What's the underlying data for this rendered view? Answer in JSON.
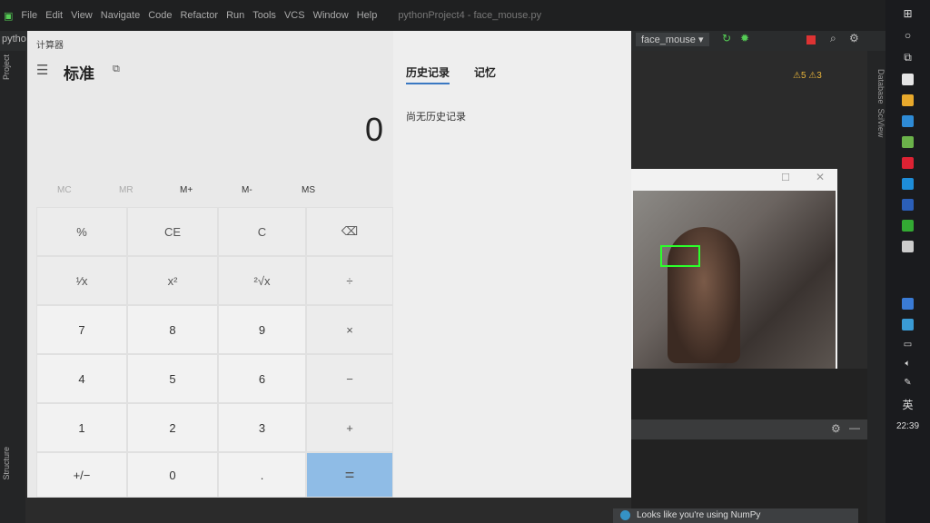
{
  "ide": {
    "menu": [
      "File",
      "Edit",
      "View",
      "Navigate",
      "Code",
      "Refactor",
      "Run",
      "Tools",
      "VCS",
      "Window",
      "Help"
    ],
    "title": "pythonProject4 - face_mouse.py",
    "project": "pytho",
    "run_config": "face_mouse",
    "warnings": "5",
    "weak_warnings": "3",
    "side_tabs": [
      "Database",
      "SciView"
    ],
    "left_tabs": [
      "Project",
      "Structure"
    ],
    "notification": "Looks like you're using NumPy"
  },
  "calculator": {
    "window_title": "计算器",
    "mode": "标准",
    "display": "0",
    "memory": [
      "MC",
      "MR",
      "M+",
      "M-",
      "MS"
    ],
    "buttons": [
      [
        "%",
        "CE",
        "C",
        "⌫"
      ],
      [
        "¹⁄x",
        "x²",
        "²√x",
        "÷"
      ],
      [
        "7",
        "8",
        "9",
        "×"
      ],
      [
        "4",
        "5",
        "6",
        "−"
      ],
      [
        "1",
        "2",
        "3",
        "+"
      ],
      [
        "+/−",
        "0",
        ".",
        "="
      ]
    ],
    "tabs": [
      "历史记录",
      "记忆"
    ],
    "history_empty": "尚无历史记录",
    "accent": "#8fbce6"
  },
  "taskbar": {
    "ime": "英",
    "clock": "22:39"
  }
}
